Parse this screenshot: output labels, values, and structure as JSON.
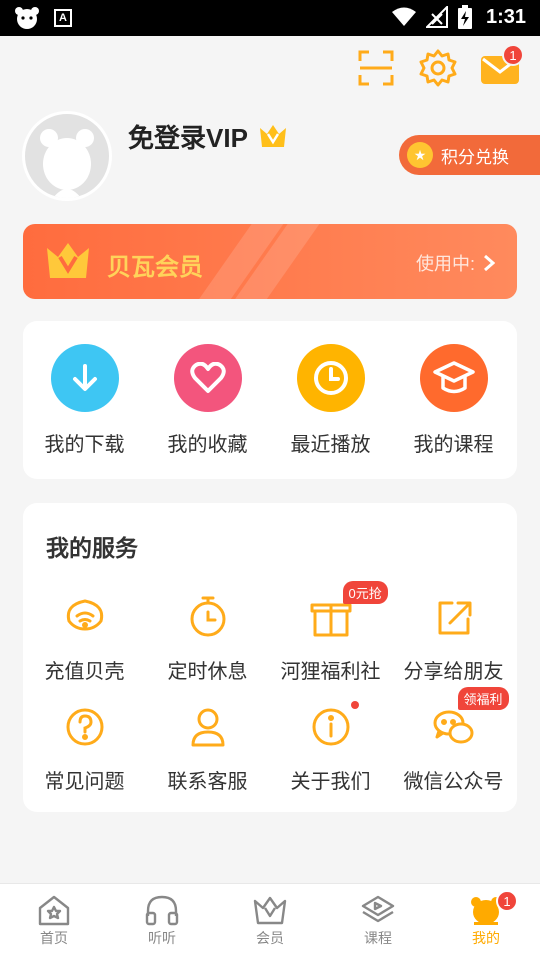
{
  "status_bar": {
    "time": "1:31",
    "notif_icon_letter": "A"
  },
  "header": {
    "mail_badge": "1"
  },
  "profile": {
    "username": "免登录VIP",
    "points_button": "积分兑换",
    "vip_badge_icon": "crown-v-icon"
  },
  "vip_banner": {
    "title": "贝瓦会员",
    "status": "使用中:"
  },
  "quick_actions": [
    {
      "label": "我的下载",
      "icon": "download-icon",
      "color": "#3ec6f3"
    },
    {
      "label": "我的收藏",
      "icon": "heart-icon",
      "color": "#f3557d"
    },
    {
      "label": "最近播放",
      "icon": "clock-icon",
      "color": "#ffb400"
    },
    {
      "label": "我的课程",
      "icon": "graduation-cap-icon",
      "color": "#ff6a2d"
    }
  ],
  "services": {
    "title": "我的服务",
    "items": [
      {
        "label": "充值贝壳",
        "icon": "shell-icon"
      },
      {
        "label": "定时休息",
        "icon": "timer-icon"
      },
      {
        "label": "河狸福利社",
        "icon": "gift-icon",
        "tag": "0元抢"
      },
      {
        "label": "分享给朋友",
        "icon": "share-icon"
      },
      {
        "label": "常见问题",
        "icon": "question-icon"
      },
      {
        "label": "联系客服",
        "icon": "customer-service-icon"
      },
      {
        "label": "关于我们",
        "icon": "info-icon"
      },
      {
        "label": "微信公众号",
        "icon": "wechat-icon",
        "tag": "领福利"
      }
    ]
  },
  "bottom_nav": {
    "items": [
      {
        "label": "首页",
        "icon": "home-icon"
      },
      {
        "label": "听听",
        "icon": "headphones-icon"
      },
      {
        "label": "会员",
        "icon": "crown-icon"
      },
      {
        "label": "课程",
        "icon": "course-icon"
      },
      {
        "label": "我的",
        "icon": "profile-mascot-icon",
        "badge": "1",
        "active": true
      }
    ]
  },
  "colors": {
    "accent": "#ffaa00",
    "orange": "#ff6c3e",
    "badge_red": "#f0453a",
    "icon_orange": "#ffab1a"
  }
}
